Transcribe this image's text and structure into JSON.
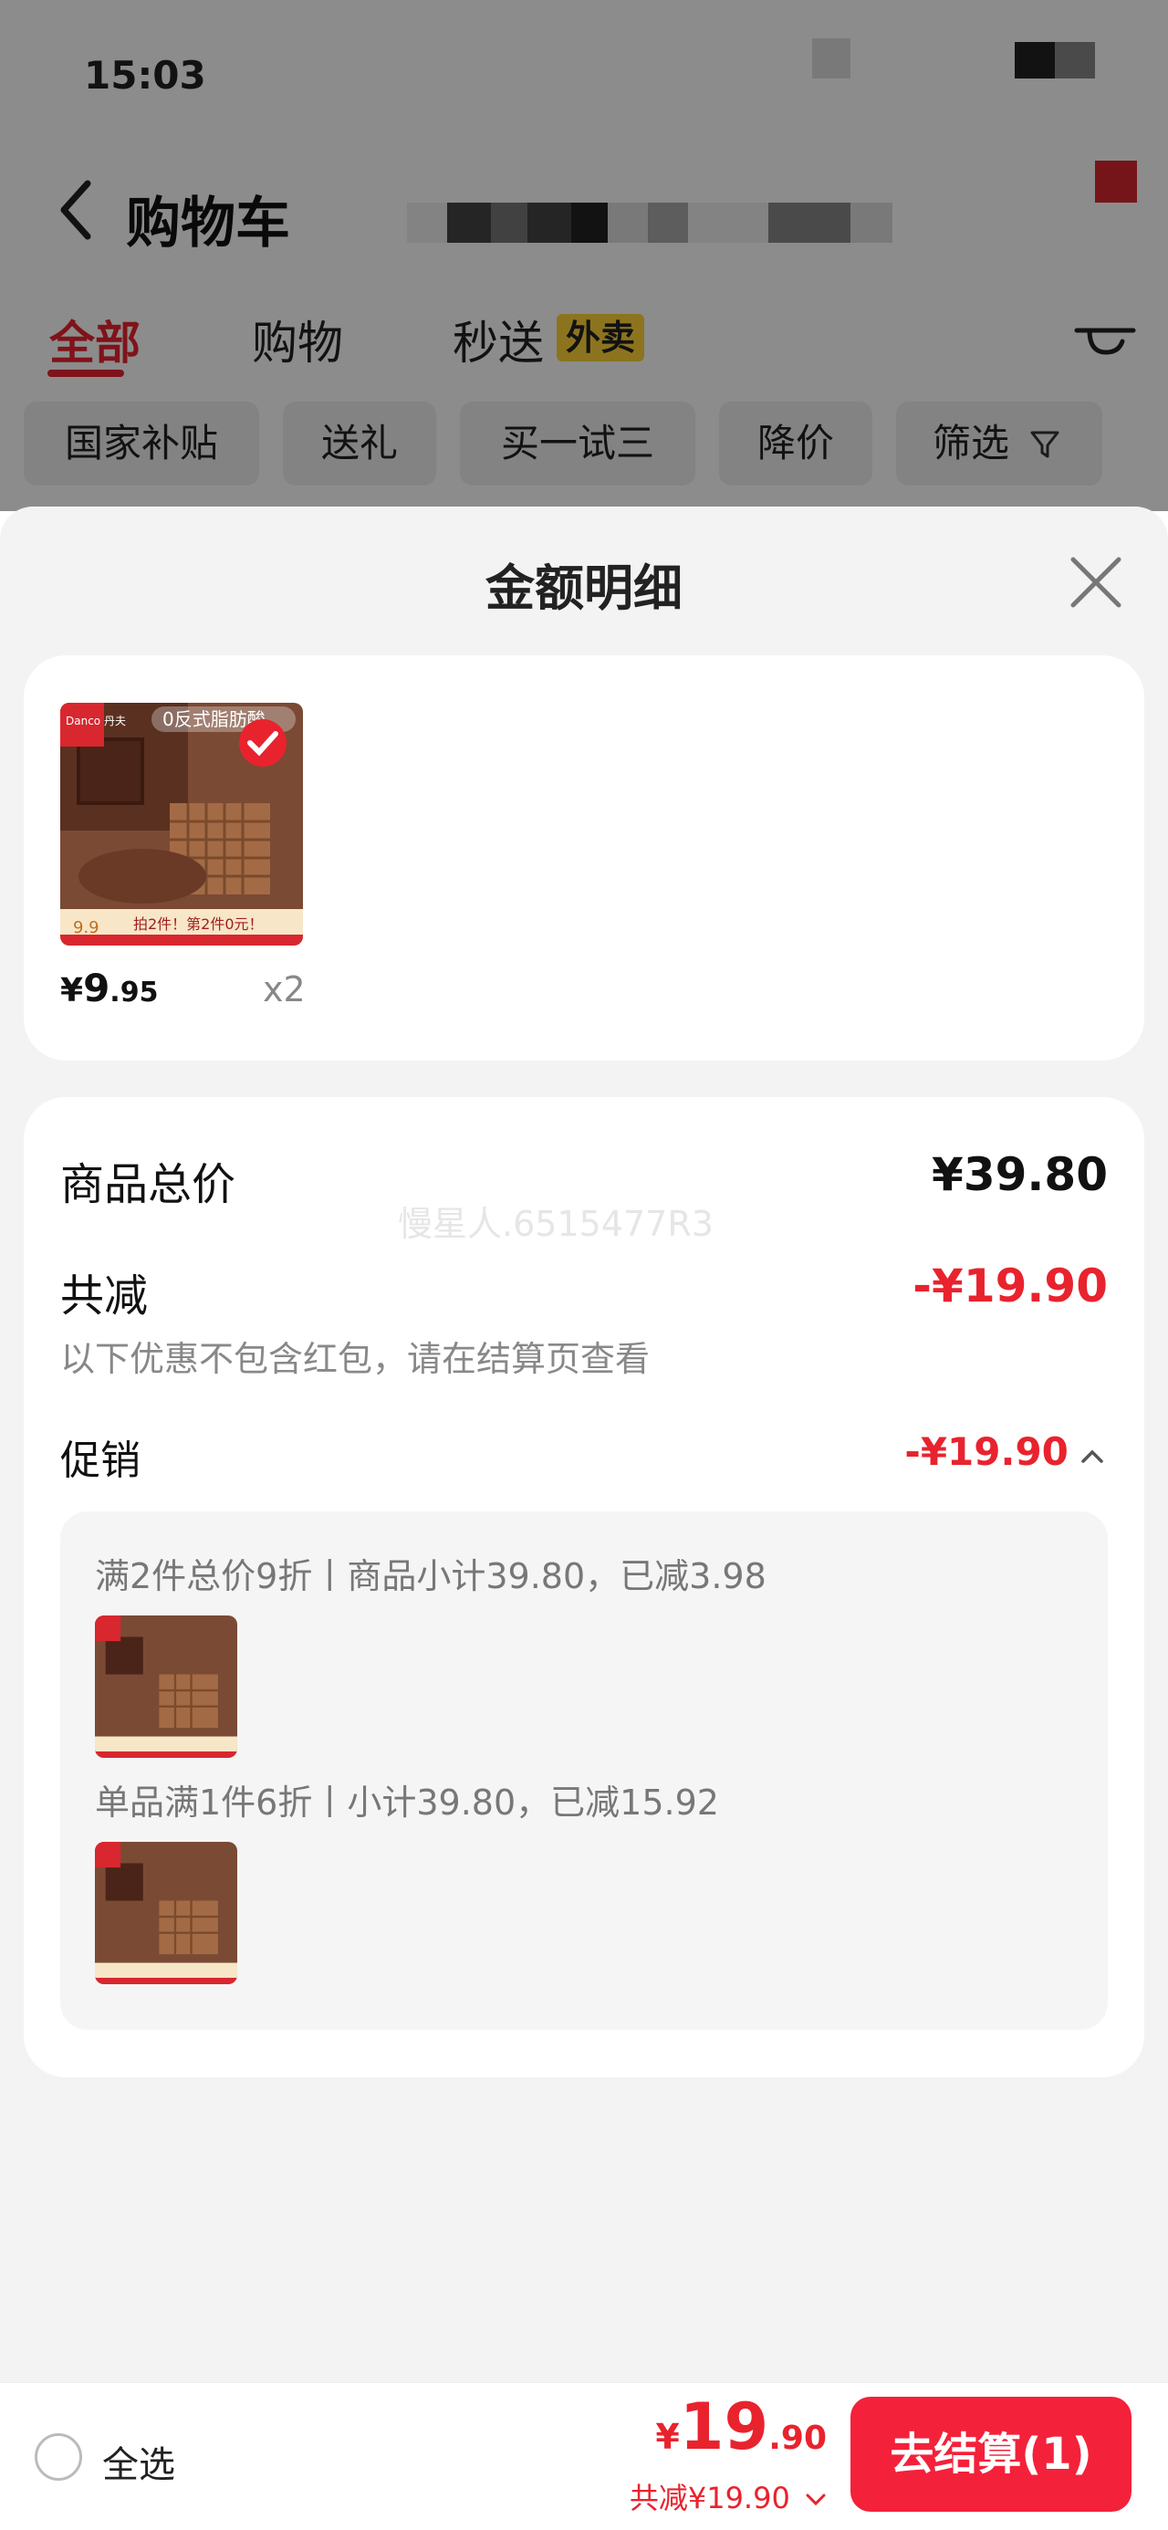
{
  "status_bar": {
    "time": "15:03"
  },
  "header": {
    "title": "购物车"
  },
  "tabs": [
    {
      "label": "全部"
    },
    {
      "label": "购物"
    },
    {
      "label": "秒送",
      "badge": "外卖"
    }
  ],
  "filter_chips": [
    {
      "label": "国家补贴"
    },
    {
      "label": "送礼"
    },
    {
      "label": "买一试三"
    },
    {
      "label": "降价"
    },
    {
      "label": "筛选"
    }
  ],
  "sheet": {
    "title": "金额明细",
    "product": {
      "price_symbol": "¥",
      "price_int": "9",
      "price_dec": ".95",
      "quantity": "x2",
      "image_text": {
        "brand": "Danco 丹夫",
        "tag": "0反式脂肪酸",
        "banner": "拍2件！第2件0元！",
        "price": "9.9"
      }
    },
    "summary": {
      "total_label": "商品总价",
      "total_value": "¥39.80",
      "reduce_label": "共减",
      "reduce_value": "-¥19.90",
      "note": "以下优惠不包含红包，请在结算页查看",
      "promo_label": "促销",
      "promo_value": "-¥19.90",
      "watermark": "慢星人.6515477R3"
    },
    "promotions": [
      {
        "text": "满2件总价9折丨商品小计39.80，已减3.98"
      },
      {
        "text": "单品满1件6折丨小计39.80，已减15.92"
      }
    ]
  },
  "bottom_bar": {
    "select_all": "全选",
    "currency": "¥",
    "total_int": "19",
    "total_dec": ".90",
    "reduce_text": "共减¥19.90",
    "checkout_label": "去结算(1)"
  },
  "colors": {
    "accent": "#e8232e",
    "checkout": "#f4213a",
    "badge": "#ffd43a"
  }
}
